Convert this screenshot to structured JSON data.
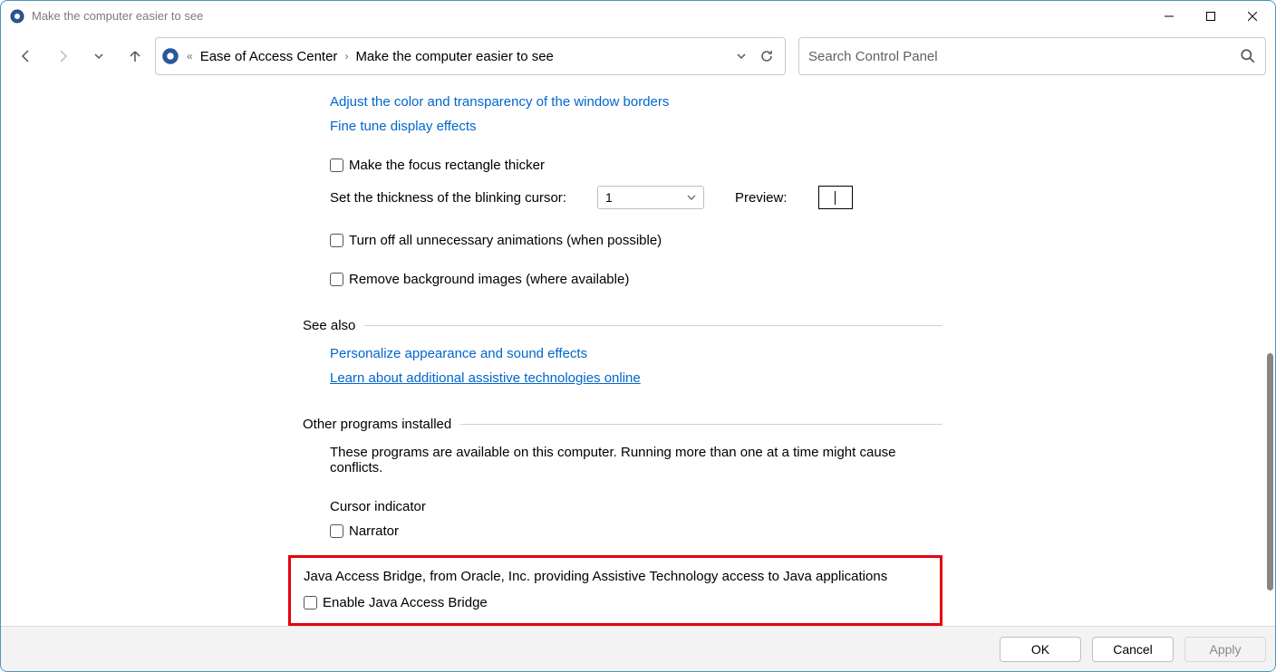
{
  "window_title": "Make the computer easier to see",
  "breadcrumb": {
    "item1": "Ease of Access Center",
    "item2": "Make the computer easier to see"
  },
  "search": {
    "placeholder": "Search Control Panel"
  },
  "links": {
    "adjust_color": "Adjust the color and transparency of the window borders",
    "fine_tune": "Fine tune display effects",
    "personalize": "Personalize appearance and sound effects",
    "learn_assistive": "Learn about additional assistive technologies online"
  },
  "labels": {
    "focus_thicker": "Make the focus rectangle thicker",
    "cursor_thickness": "Set the thickness of the blinking cursor:",
    "cursor_value": "1",
    "preview": "Preview:",
    "turn_off_animations": "Turn off all unnecessary animations (when possible)",
    "remove_bg": "Remove background images (where available)",
    "see_also": "See also",
    "other_programs": "Other programs installed",
    "other_desc": "These programs are available on this computer. Running more than one at a time might cause conflicts.",
    "cursor_indicator": "Cursor indicator",
    "narrator": "Narrator",
    "java_bridge_desc": "Java Access Bridge, from Oracle, Inc. providing Assistive Technology access to Java applications",
    "enable_java": "Enable Java Access Bridge"
  },
  "footer": {
    "ok": "OK",
    "cancel": "Cancel",
    "apply": "Apply"
  }
}
